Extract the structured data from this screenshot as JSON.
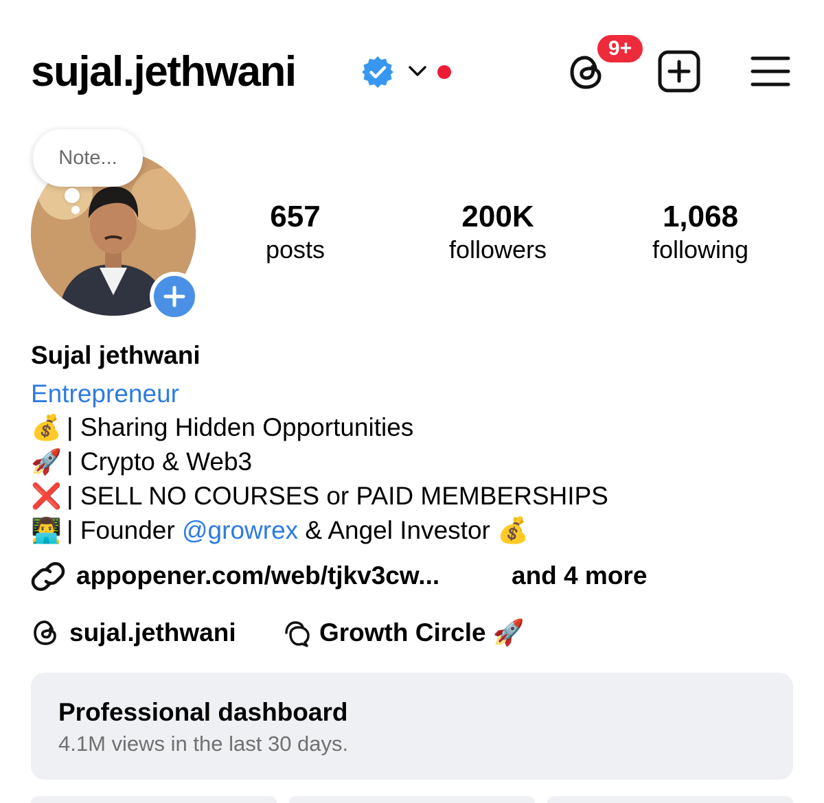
{
  "header": {
    "username": "sujal.jethwani",
    "notification_badge": "9+",
    "verified_color": "#3897f0",
    "badge_color": "#ed2b3b",
    "icons": [
      "verified-badge-icon",
      "chevron-down-icon",
      "threads-icon",
      "new-post-icon",
      "menu-icon"
    ]
  },
  "note": {
    "placeholder": "Note..."
  },
  "stats": {
    "posts": {
      "value": "657",
      "label": "posts"
    },
    "followers": {
      "value": "200K",
      "label": "followers"
    },
    "following": {
      "value": "1,068",
      "label": "following"
    }
  },
  "bio": {
    "full_name": "Sujal jethwani",
    "category": "Entrepreneur",
    "lines": [
      {
        "emoji": "💰",
        "text": "| Sharing Hidden Opportunities"
      },
      {
        "emoji": "🚀",
        "text": "| Crypto & Web3"
      },
      {
        "emoji": "❌",
        "text": "| SELL NO COURSES or PAID MEMBERSHIPS"
      },
      {
        "emoji": "👨‍💻",
        "prefix": "| Founder ",
        "mention": "@growrex",
        "suffix": " & Angel Investor 💰"
      }
    ],
    "link": "appopener.com/web/tjkv3cw...",
    "link_more": "and 4 more",
    "threads_handle": "sujal.jethwani",
    "channel_name": "Growth Circle 🚀"
  },
  "dashboard": {
    "title": "Professional dashboard",
    "subtitle": "4.1M views in the last 30 days."
  },
  "colors": {
    "accent": "#2e7be0",
    "card_bg": "#eff0f3",
    "red": "#ed1c35"
  }
}
